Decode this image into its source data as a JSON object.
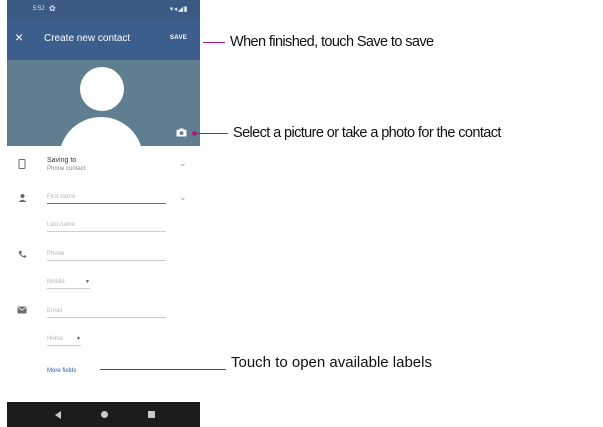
{
  "status_bar": {
    "time": "5:52",
    "settings_icon": "gear-icon",
    "icons_text": "▾◂◢▮"
  },
  "app_bar": {
    "close_icon": "close-icon",
    "close_glyph": "×",
    "title": "Create new contact",
    "save_label": "SAVE"
  },
  "photo": {
    "placeholder_icon": "avatar-placeholder",
    "camera_icon": "camera-icon"
  },
  "form": {
    "saving_to": {
      "title": "Saving to",
      "account": "Phone contact"
    },
    "first_name": {
      "placeholder": "First name"
    },
    "last_name": {
      "placeholder": "Last name"
    },
    "phone": {
      "placeholder": "Phone",
      "label_type": "Mobile"
    },
    "email": {
      "placeholder": "Email",
      "label_type": "Home"
    },
    "more_fields": "More fields"
  },
  "nav_bar": {
    "back": "back-icon",
    "home": "home-icon",
    "recents": "recents-icon"
  },
  "callouts": {
    "save": "When finished, touch Save to save",
    "photo": "Select a picture or take a photo for the contact",
    "labels": "Touch to open available labels"
  },
  "colors": {
    "app_bar": "#3c5e8c",
    "status_bar": "#3b5a84",
    "photo_bg": "#5f7e90",
    "accent": "#4d79bf",
    "link": "#2f5ea8",
    "callout": "#b0197c"
  }
}
